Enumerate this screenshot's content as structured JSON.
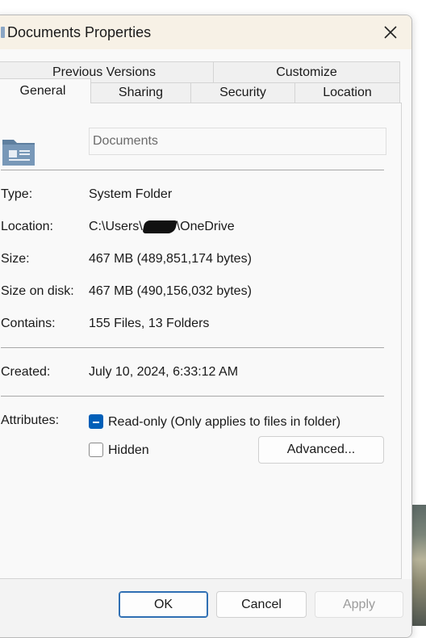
{
  "window": {
    "title": "Documents Properties"
  },
  "tabs": {
    "row1": [
      "Previous Versions",
      "Customize"
    ],
    "row2": [
      "General",
      "Sharing",
      "Security",
      "Location"
    ]
  },
  "general": {
    "name_value": "Documents",
    "type_label": "Type:",
    "type_value": "System Folder",
    "location_label": "Location:",
    "location_prefix": "C:\\Users\\",
    "location_suffix": "\\OneDrive",
    "size_label": "Size:",
    "size_value": "467 MB (489,851,174 bytes)",
    "size_on_disk_label": "Size on disk:",
    "size_on_disk_value": "467 MB (490,156,032 bytes)",
    "contains_label": "Contains:",
    "contains_value": "155 Files, 13 Folders",
    "created_label": "Created:",
    "created_value": "July 10, 2024, 6:33:12 AM",
    "attributes_label": "Attributes:",
    "readonly_label": "Read-only (Only applies to files in folder)",
    "hidden_label": "Hidden",
    "advanced_label": "Advanced..."
  },
  "footer": {
    "ok": "OK",
    "cancel": "Cancel",
    "apply": "Apply"
  },
  "icons": {
    "close": "close-icon",
    "folder": "documents-folder-icon"
  },
  "colors": {
    "accent": "#005fb8",
    "titlebar": "#f7f1e6"
  }
}
